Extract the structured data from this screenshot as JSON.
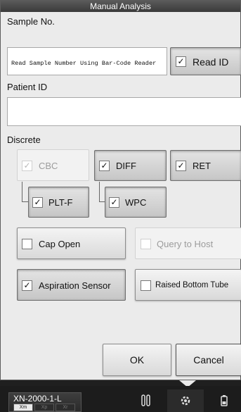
{
  "dialog": {
    "title": "Manual Analysis",
    "sample_label": "Sample No.",
    "sample_hint": "Read Sample Number Using Bar-Code Reader",
    "read_id": {
      "label": "Read ID",
      "mark": "✓"
    },
    "patient_label": "Patient ID",
    "patient_value": "",
    "discrete_label": "Discrete",
    "discrete": {
      "cbc": {
        "label": "CBC",
        "mark": "✓"
      },
      "diff": {
        "label": "DIFF",
        "mark": "✓"
      },
      "ret": {
        "label": "RET",
        "mark": "✓"
      },
      "pltf": {
        "label": "PLT-F",
        "mark": "✓"
      },
      "wpc": {
        "label": "WPC",
        "mark": "✓"
      }
    },
    "cap_open": {
      "label": "Cap Open",
      "mark": ""
    },
    "query_host": {
      "label": "Query to Host",
      "mark": ""
    },
    "aspiration": {
      "label": "Aspiration Sensor",
      "mark": "✓"
    },
    "raised_bottom": {
      "label": "Raised Bottom Tube",
      "mark": ""
    },
    "ok_label": "OK",
    "cancel_label": "Cancel"
  },
  "bottom_bar": {
    "instrument": "XN-2000-1-L",
    "mini_tabs": [
      "Xm",
      "Xp",
      "Xr"
    ],
    "nav_icons": [
      "tube-rack-icon",
      "analyzer-gear-icon",
      "bottle-icon"
    ]
  }
}
